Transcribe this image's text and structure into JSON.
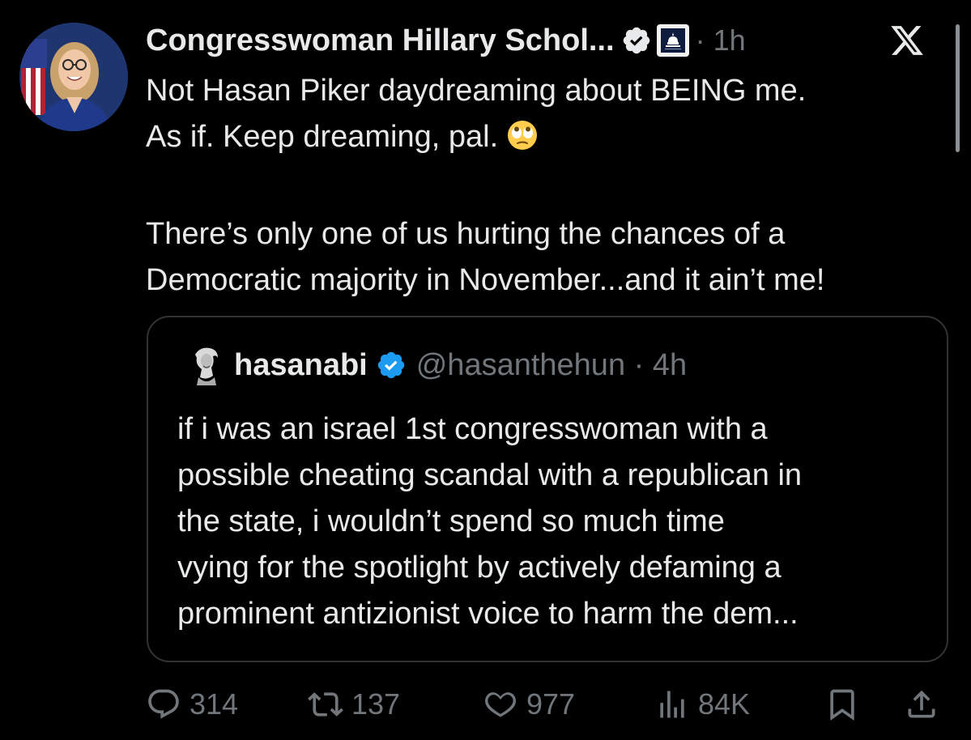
{
  "tweet": {
    "display_name": "Congresswoman Hillary Schol...",
    "separator": "·",
    "time": "1h",
    "lines": [
      "Not Hasan Piker daydreaming about BEING me.",
      "As if. Keep dreaming, pal.",
      "There’s only one of us hurting the chances of a",
      "Democratic majority in November...and it ain’t me!"
    ],
    "emoji": "face-with-rolling-eyes"
  },
  "quote": {
    "display_name": "hasanabi",
    "handle": "@hasanthehun",
    "separator": "·",
    "time": "4h",
    "lines": [
      "if i was an israel 1st congresswoman with a",
      "possible cheating scandal with a republican in",
      "the state, i wouldn’t spend so much time",
      "vying for the spotlight by actively defaming a",
      "prominent antizionist voice to harm the dem..."
    ]
  },
  "actions": {
    "replies": "314",
    "reposts": "137",
    "likes": "977",
    "views": "84K"
  },
  "colors": {
    "background": "#000000",
    "text": "#e7e9ea",
    "muted": "#71767b",
    "verified": "#1d9bf0",
    "border": "#2f3336"
  },
  "icons": [
    "verified-badge-icon",
    "government-badge-icon",
    "x-logo-icon",
    "reply-icon",
    "repost-icon",
    "like-icon",
    "views-icon",
    "bookmark-icon",
    "share-icon"
  ]
}
